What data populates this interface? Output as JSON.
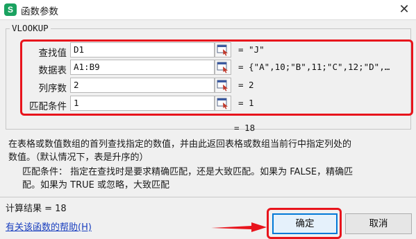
{
  "window": {
    "app_icon": "S",
    "title": "函数参数",
    "close_glyph": "✕"
  },
  "function": {
    "name": "VLOOKUP",
    "result": "= 18"
  },
  "params": [
    {
      "label": "查找值",
      "value": "D1",
      "result": "= \"J\""
    },
    {
      "label": "数据表",
      "value": "A1:B9",
      "result": "= {\"A\",10;\"B\",11;\"C\",12;\"D\",…"
    },
    {
      "label": "列序数",
      "value": "2",
      "result": "= 2"
    },
    {
      "label": "匹配条件",
      "value": "1",
      "result": "= 1"
    }
  ],
  "description": {
    "line1": "在表格或数值数组的首列查找指定的数值，并由此返回表格或数组当前行中指定列处的",
    "line2": "数值。（默认情况下，表是升序的）"
  },
  "param_description": {
    "line1": "匹配条件：  指定在查找时是要求精确匹配，还是大致匹配。如果为 FALSE，精确匹",
    "line2": "配。如果为 TRUE 或忽略，大致匹配"
  },
  "footer": {
    "calc_result": "计算结果 = 18",
    "help_link": "有关该函数的帮助(H)",
    "ok_label": "确定",
    "cancel_label": "取消"
  },
  "icons": {
    "ref_button": "range-select-icon",
    "arrow": "red-arrow-icon"
  },
  "colors": {
    "highlight": "#e8141c",
    "app_icon": "#1aa260",
    "link": "#1a3fbf",
    "ok_border": "#0078d7"
  }
}
